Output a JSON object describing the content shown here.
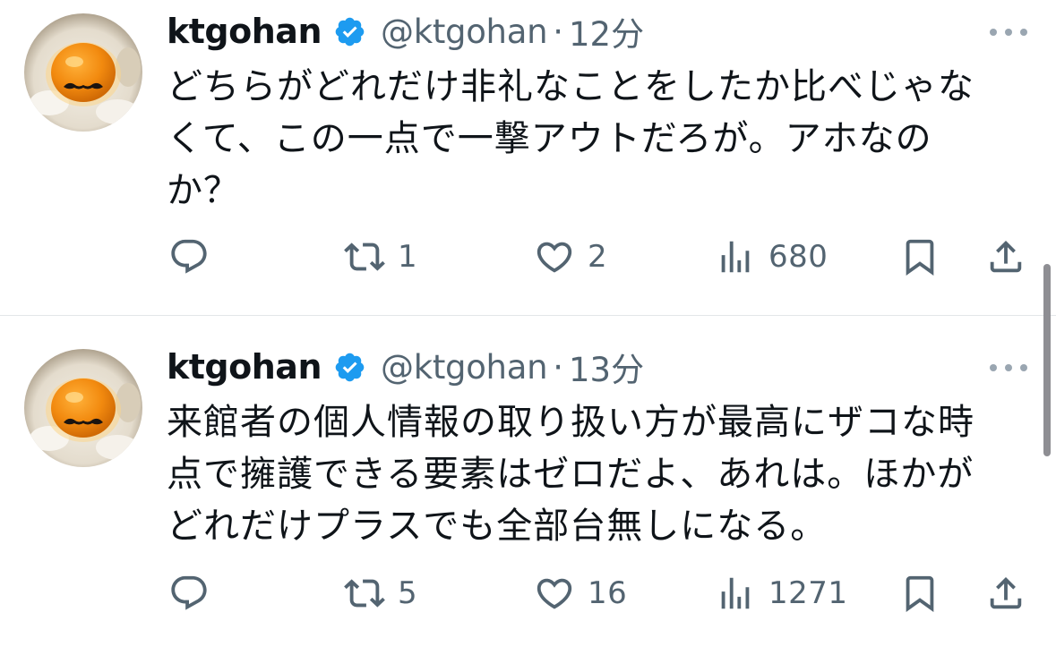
{
  "tweets": [
    {
      "display_name": "ktgohan",
      "handle": "@ktgohan",
      "separator": "·",
      "time": "12分",
      "text": "どちらがどれだけ非礼なことをしたか比べじゃな\nくて、この一点で一撃アウトだろが。アホなの\nか？",
      "reply_count": "",
      "retweet_count": "1",
      "like_count": "2",
      "view_count": "680"
    },
    {
      "display_name": "ktgohan",
      "handle": "@ktgohan",
      "separator": "·",
      "time": "13分",
      "text": "来館者の個人情報の取り扱い方が最高にザコな時\n点で擁護できる要素はゼロだよ、あれは。ほかが\nどれだけプラスでも全部台無しになる。",
      "reply_count": "",
      "retweet_count": "5",
      "like_count": "16",
      "view_count": "1271"
    }
  ],
  "icons": {
    "avatar": "egg-on-rice-with-mustache",
    "verified": "verified-badge-icon",
    "more": "more-dots-icon",
    "reply": "reply-icon",
    "retweet": "retweet-icon",
    "like": "heart-icon",
    "views": "views-icon",
    "bookmark": "bookmark-icon",
    "share": "share-icon"
  },
  "colors": {
    "verified": "#1d9bf0",
    "text": "#0f1419",
    "secondary": "#536471",
    "divider": "#e3e6e8"
  }
}
